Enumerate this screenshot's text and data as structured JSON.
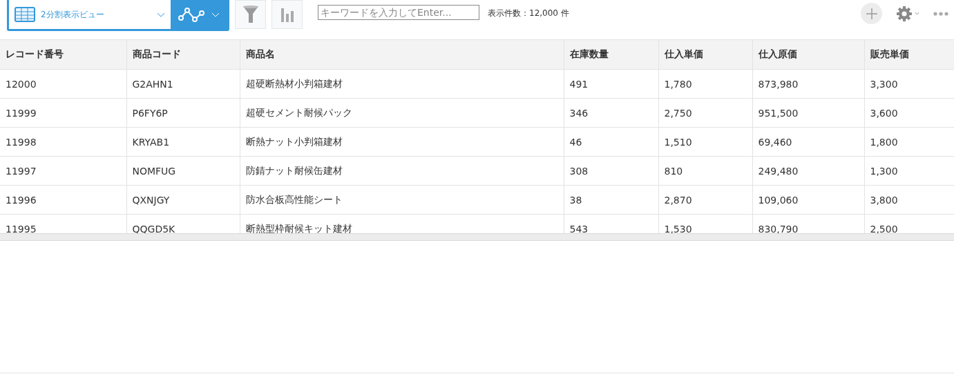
{
  "toolbar": {
    "view_name": "2分割表示ビュー",
    "search": {
      "placeholder": "キーワードを入力してEnter..."
    },
    "record_count": "表示件数：12,000 件"
  },
  "table": {
    "columns": [
      "レコード番号",
      "商品コード",
      "商品名",
      "在庫数量",
      "仕入単価",
      "仕入原価",
      "販売単価"
    ],
    "rows": [
      [
        "12000",
        "G2AHN1",
        "超硬断熱材小判箱建材",
        "491",
        "1,780",
        "873,980",
        "3,300"
      ],
      [
        "11999",
        "P6FY6P",
        "超硬セメント耐候パック",
        "346",
        "2,750",
        "951,500",
        "3,600"
      ],
      [
        "11998",
        "KRYAB1",
        "断熱ナット小判箱建材",
        "46",
        "1,510",
        "69,460",
        "1,800"
      ],
      [
        "11997",
        "NOMFUG",
        "防錆ナット耐候缶建材",
        "308",
        "810",
        "249,480",
        "1,300"
      ],
      [
        "11996",
        "QXNJGY",
        "防水合板高性能シート",
        "38",
        "2,870",
        "109,060",
        "3,800"
      ],
      [
        "11995",
        "QQGD5K",
        "断熱型枠耐候キット建材",
        "543",
        "1,530",
        "830,790",
        "2,500"
      ]
    ]
  }
}
